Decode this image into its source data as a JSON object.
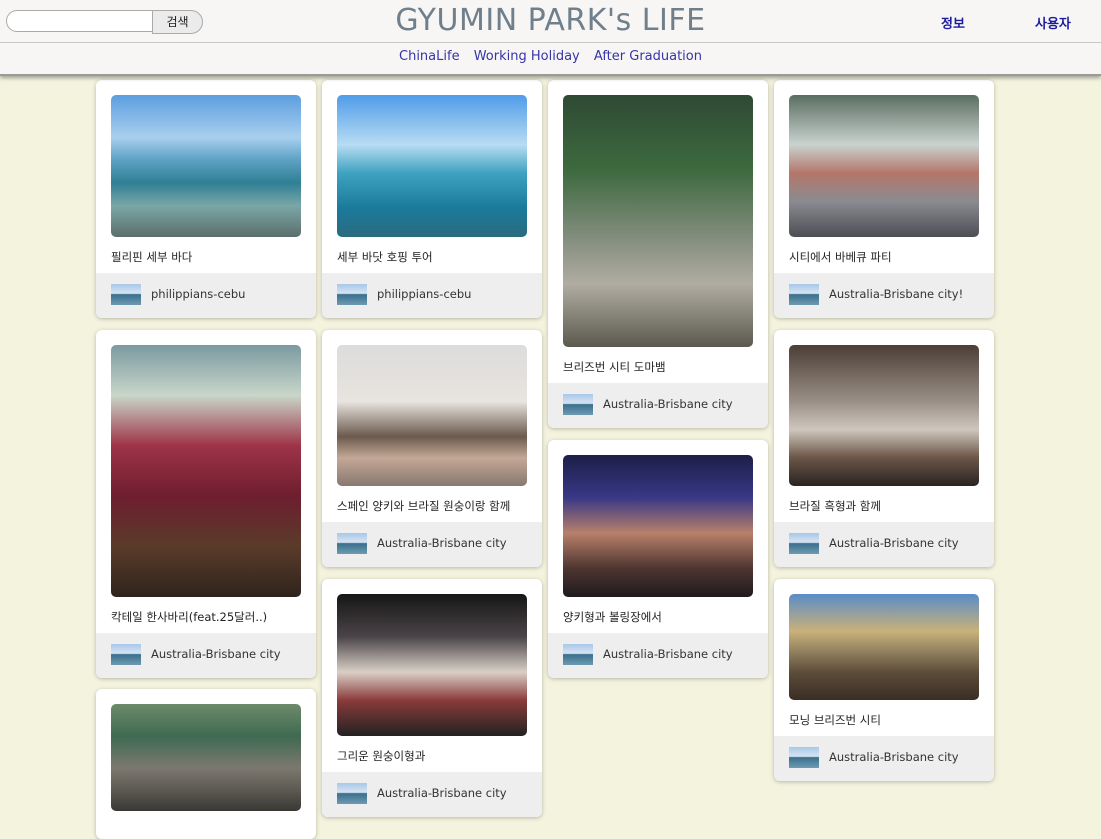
{
  "search": {
    "placeholder": "",
    "button_label": "검색"
  },
  "site": {
    "title": "GYUMIN PARK's LIFE"
  },
  "nav": {
    "info": "정보",
    "user": "사용자"
  },
  "subnav": [
    "ChinaLife",
    "Working Holiday",
    "After Graduation"
  ],
  "posts": [
    {
      "caption": "필리핀 세부 바다",
      "location": "philippians-cebu",
      "photo": "sea-boat-photo"
    },
    {
      "caption": "세부 바닷 호핑 투어",
      "location": "philippians-cebu",
      "photo": "sea-selfie-photo"
    },
    {
      "caption": "브리즈번 시티 도마뱀",
      "location": "Australia-Brisbane city",
      "photo": "lizard-pond-photo"
    },
    {
      "caption": "시티에서 바베큐 파티",
      "location": "Australia-Brisbane city!",
      "photo": "bbq-party-photo"
    },
    {
      "caption": "칵테일 한사바리(feat.25달러..)",
      "location": "Australia-Brisbane city",
      "photo": "cocktail-photo"
    },
    {
      "caption": "스페인 양키와 브라질 원숭이랑 함께",
      "location": "Australia-Brisbane city",
      "photo": "kitchen-friends-photo"
    },
    {
      "caption": "양키형과 볼링장에서",
      "location": "Australia-Brisbane city",
      "photo": "bowling-selfie-photo"
    },
    {
      "caption": "브라질 흑형과 함께",
      "location": "Australia-Brisbane city",
      "photo": "kitchen-cooking-photo"
    },
    {
      "caption": "그리운 원숭이형과",
      "location": "Australia-Brisbane city",
      "photo": "club-selfie-photo"
    },
    {
      "caption": "모닝 브리즈번 시티",
      "location": "Australia-Brisbane city",
      "photo": "city-balcony-photo"
    },
    {
      "caption": "",
      "location": "",
      "photo": "zoo-group-photo"
    }
  ]
}
